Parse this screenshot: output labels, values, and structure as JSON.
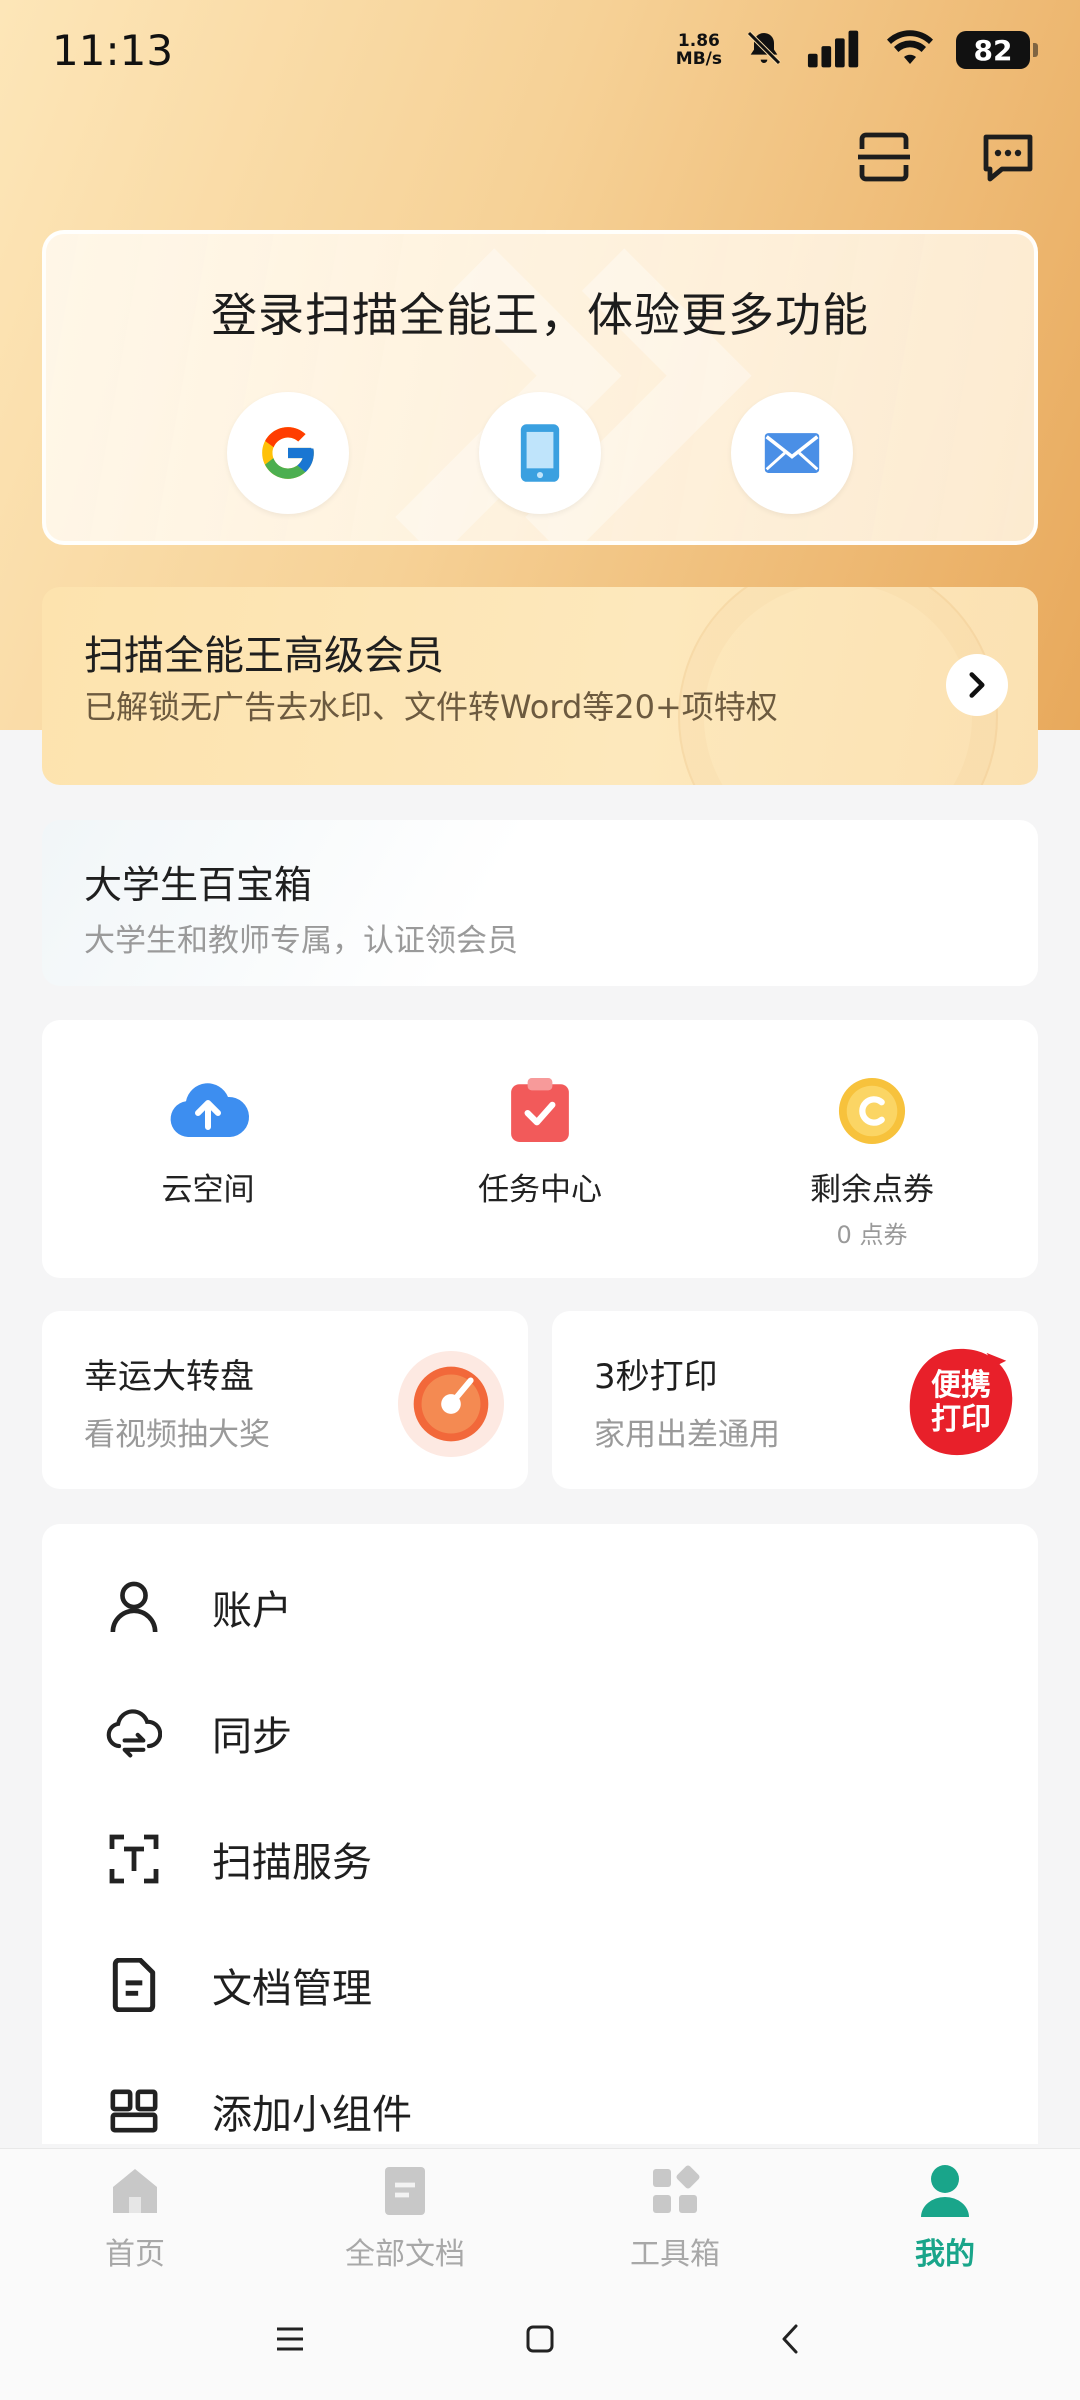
{
  "status": {
    "time": "11:13",
    "net_speed_value": "1.86",
    "net_speed_unit": "MB/s",
    "battery": "82"
  },
  "login": {
    "title": "登录扫描全能王，体验更多功能",
    "options": [
      "google-login",
      "phone-login",
      "email-login"
    ]
  },
  "vip": {
    "title": "扫描全能王高级会员",
    "subtitle": "已解锁无广告去水印、文件转Word等20+项特权"
  },
  "student": {
    "title": "大学生百宝箱",
    "subtitle": "大学生和教师专属，认证领会员"
  },
  "quick": {
    "items": [
      {
        "label": "云空间",
        "sub": ""
      },
      {
        "label": "任务中心",
        "sub": ""
      },
      {
        "label": "剩余点券",
        "sub": "0 点券"
      }
    ]
  },
  "promos": {
    "left": {
      "title": "幸运大转盘",
      "subtitle": "看视频抽大奖"
    },
    "right": {
      "title": "3秒打印",
      "subtitle": "家用出差通用",
      "badge": "便携打印"
    }
  },
  "menu": {
    "items": [
      {
        "label": "账户",
        "icon": "person-icon"
      },
      {
        "label": "同步",
        "icon": "cloud-sync-icon"
      },
      {
        "label": "扫描服务",
        "icon": "text-scan-icon"
      },
      {
        "label": "文档管理",
        "icon": "document-icon"
      },
      {
        "label": "添加小组件",
        "icon": "widget-icon"
      }
    ]
  },
  "tabs": [
    {
      "label": "首页",
      "icon": "home-icon",
      "active": false
    },
    {
      "label": "全部文档",
      "icon": "documents-icon",
      "active": false
    },
    {
      "label": "工具箱",
      "icon": "toolbox-icon",
      "active": false
    },
    {
      "label": "我的",
      "icon": "profile-icon",
      "active": true
    }
  ],
  "colors": {
    "accent": "#19a58a",
    "hero_start": "#fde6b8",
    "hero_end": "#e8a95c",
    "vip_bg": "#fde3ae"
  }
}
